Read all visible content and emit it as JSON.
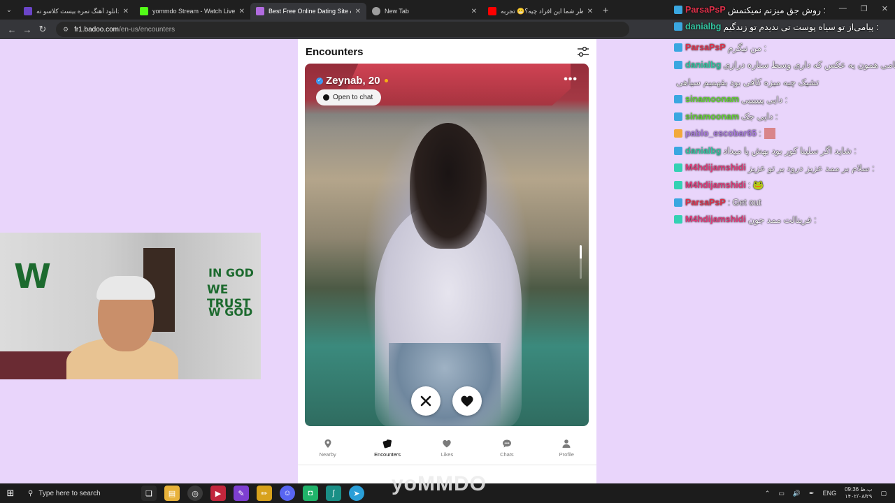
{
  "browser": {
    "tabs": [
      {
        "title": "دانلود آهنگ نمره بیست کلاسو نه",
        "favicon_color": "#6b45c9",
        "active": false
      },
      {
        "title": "yommdo Stream - Watch Live o",
        "favicon_color": "#53fc18",
        "active": false
      },
      {
        "title": "Best Free Online Dating Site &",
        "favicon_color": "#b16be0",
        "active": true
      },
      {
        "title": "New Tab",
        "favicon_color": "#9e9e9e",
        "active": false
      },
      {
        "title": "نظر شما این افراد چیه؟😬 تجربه",
        "favicon_color": "#ff0000",
        "active": false
      }
    ],
    "new_tab": "+",
    "url_host": "fr1.badoo.com",
    "url_path": "/en-us/encounters"
  },
  "app": {
    "title": "Encounters",
    "profile": {
      "name": "Zeynab, 20",
      "open_chat_label": "Open to chat",
      "verified": true,
      "online": true
    },
    "nav": [
      {
        "label": "Nearby",
        "icon": "location-pin-icon",
        "active": false
      },
      {
        "label": "Encounters",
        "icon": "cards-icon",
        "active": true
      },
      {
        "label": "Likes",
        "icon": "heart-icon",
        "active": false
      },
      {
        "label": "Chats",
        "icon": "chat-bubble-icon",
        "active": false
      },
      {
        "label": "Profile",
        "icon": "person-icon",
        "active": false
      }
    ]
  },
  "webcam": {
    "wall_text_1": "IN GOD",
    "wall_text_2": "WE TRUST",
    "wall_text_3": "W GOD"
  },
  "chat_top": [
    {
      "user": "ParsaPsP",
      "user_color": "#e0304a",
      "msg": "روش جق میزنم نمیکنمش :",
      "badge_color": "#3aa7e0"
    },
    {
      "user": "danialbg",
      "user_color": "#33c4a0",
      "msg": "پیامی‌از تو سیاه پوست تی ندیدم تو زندگیم :",
      "badge_color": "#3aa7e0"
    }
  ],
  "chat": [
    {
      "user": "ParsaPsP",
      "user_color": "#e0304a",
      "msg": "من نیگرم :",
      "badge_color": "#3aa7e0"
    },
    {
      "user": "danialbg",
      "user_color": "#33c4a0",
      "msg": "سامی همون یه عکس که داری وسط ستاره درازی",
      "badge_color": "#3aa7e0"
    },
    {
      "user": "",
      "user_color": "#33c4a0",
      "msg": "تشیک چیه میزه کافی بود بقهمیم سیاهی",
      "badge_color": ""
    },
    {
      "user": "sinamoonam",
      "user_color": "#62d432",
      "msg": "دایی پیییییی :",
      "badge_color": "#3aa7e0"
    },
    {
      "user": "sinamoonam",
      "user_color": "#62d432",
      "msg": "دایی جک :",
      "badge_color": "#3aa7e0"
    },
    {
      "user": "pablo_escobar65",
      "user_color": "#a77bdc",
      "msg": ":",
      "badge_color": "#f2a93b"
    },
    {
      "user": "danialbg",
      "user_color": "#33c4a0",
      "msg": "شاید اگر سلینا کور بود بهش پا میداد :",
      "badge_color": "#3aa7e0"
    },
    {
      "user": "M4hdijamshidi",
      "user_color": "#e03a7a",
      "msg": "سلام بر ممد عزیز درود بر تو عزیز :",
      "badge_color": "#34d1b3"
    },
    {
      "user": "M4hdijamshidi",
      "user_color": "#e03a7a",
      "msg": ": 🐸",
      "badge_color": "#34d1b3"
    },
    {
      "user": "ParsaPsP",
      "user_color": "#e0304a",
      "msg": ": Get out",
      "badge_color": "#3aa7e0"
    },
    {
      "user": "M4hdijamshidi",
      "user_color": "#e03a7a",
      "msg": "فرینالت ممد جون :",
      "badge_color": "#34d1b3"
    }
  ],
  "watermark": "yoMMDO",
  "taskbar": {
    "search_placeholder": "Type here to search",
    "lang": "ENG",
    "time": "09:36 ب.ظ",
    "date": "۱۴۰۲/۰۸/۲۹"
  }
}
